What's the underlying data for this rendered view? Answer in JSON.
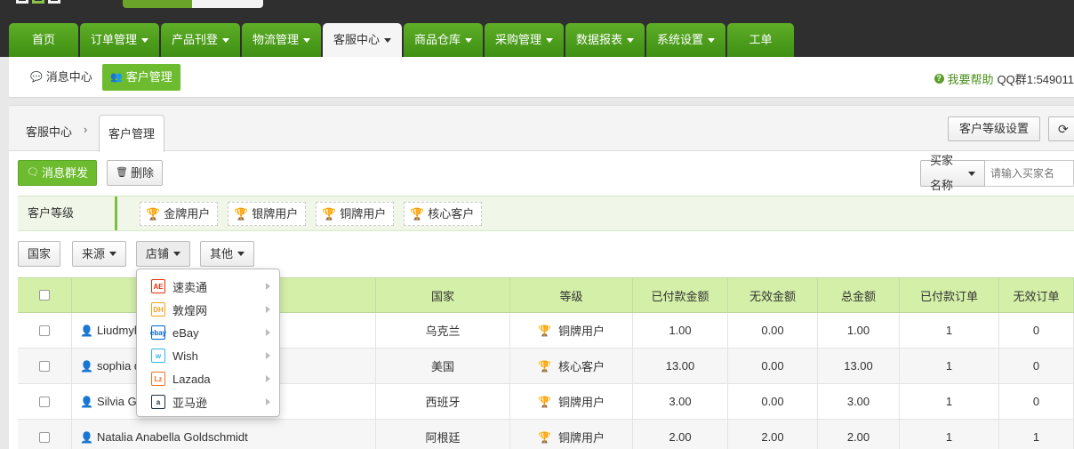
{
  "nav": {
    "tabs": [
      {
        "label": "首页",
        "dropdown": false,
        "active": false
      },
      {
        "label": "订单管理",
        "dropdown": true,
        "active": false
      },
      {
        "label": "产品刊登",
        "dropdown": true,
        "active": false
      },
      {
        "label": "物流管理",
        "dropdown": true,
        "active": false
      },
      {
        "label": "客服中心",
        "dropdown": true,
        "active": true
      },
      {
        "label": "商品仓库",
        "dropdown": true,
        "active": false
      },
      {
        "label": "采购管理",
        "dropdown": true,
        "active": false
      },
      {
        "label": "数据报表",
        "dropdown": true,
        "active": false
      },
      {
        "label": "系统设置",
        "dropdown": true,
        "active": false
      },
      {
        "label": "工单",
        "dropdown": false,
        "active": false
      }
    ]
  },
  "subnav": {
    "message_center": "消息中心",
    "customer_manage": "客户管理",
    "help_link": "我要帮助",
    "qq_group": "QQ群1:549011"
  },
  "breadcrumb": {
    "home": "客服中心",
    "separator": "›",
    "current": "客户管理"
  },
  "toolbar": {
    "level_settings": "客户等级设置",
    "broadcast": "消息群发",
    "delete": "删除",
    "buyer_select": "买家名称",
    "buyer_placeholder": "请输入买家名"
  },
  "levels": {
    "label": "客户等级",
    "tags": [
      {
        "label": "金牌用户",
        "color": "#d9a400"
      },
      {
        "label": "银牌用户",
        "color": "#5a9a1e"
      },
      {
        "label": "铜牌用户",
        "color": "#b8561c"
      },
      {
        "label": "核心客户",
        "color": "#d9a400"
      }
    ]
  },
  "filters": {
    "country": "国家",
    "source": "来源",
    "store": "店铺",
    "other": "其他"
  },
  "store_dropdown": {
    "items": [
      {
        "label": "速卖通",
        "logo": "AE",
        "color": "#e62e04"
      },
      {
        "label": "敦煌网",
        "logo": "DH",
        "color": "#f1a11c"
      },
      {
        "label": "eBay",
        "logo": "ebay",
        "color": "#0064d2"
      },
      {
        "label": "Wish",
        "logo": "w",
        "color": "#2fb7ec"
      },
      {
        "label": "Lazada",
        "logo": "Lz",
        "color": "#f36f21"
      },
      {
        "label": "亚马逊",
        "logo": "a",
        "color": "#232f3e"
      }
    ]
  },
  "table": {
    "headers": [
      "",
      "",
      "国家",
      "等级",
      "已付款金额",
      "无效金额",
      "总金额",
      "已付款订单",
      "无效订单"
    ],
    "rows": [
      {
        "name": "Liudmyla",
        "country": "乌克兰",
        "level": "铜牌用户",
        "level_color": "#b8561c",
        "paid": "1.00",
        "invalid": "0.00",
        "total": "1.00",
        "paid_orders": "1",
        "invalid_orders": "0"
      },
      {
        "name": "sophia de",
        "country": "美国",
        "level": "核心客户",
        "level_color": "#d9a400",
        "paid": "13.00",
        "invalid": "0.00",
        "total": "13.00",
        "paid_orders": "1",
        "invalid_orders": "0"
      },
      {
        "name": "Silvia Guis",
        "country": "西班牙",
        "level": "铜牌用户",
        "level_color": "#b8561c",
        "paid": "3.00",
        "invalid": "0.00",
        "total": "3.00",
        "paid_orders": "1",
        "invalid_orders": "0"
      },
      {
        "name": "Natalia Anabella Goldschmidt",
        "country": "阿根廷",
        "level": "铜牌用户",
        "level_color": "#b8561c",
        "paid": "2.00",
        "invalid": "2.00",
        "total": "2.00",
        "paid_orders": "1",
        "invalid_orders": "1"
      }
    ]
  },
  "colors": {
    "nav_green": "#4c9c1c",
    "accent_green": "#6dbb2f",
    "table_header": "#d4f0a8"
  }
}
